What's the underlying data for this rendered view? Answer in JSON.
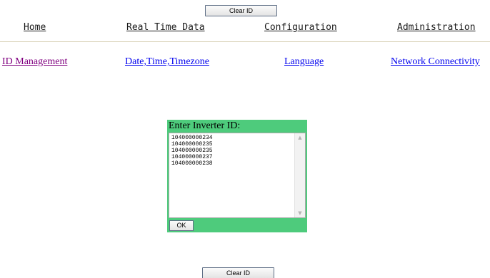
{
  "top_button": {
    "label": "Clear ID"
  },
  "bottom_button": {
    "label": "Clear ID"
  },
  "main_nav": {
    "home": "Home",
    "real_time_data": "Real Time Data",
    "configuration": "Configuration",
    "administration": "Administration"
  },
  "sub_nav": {
    "id_management": "ID Management",
    "date_time": "Date,Time,Timezone",
    "language": "Language",
    "network": "Network Connectivity"
  },
  "inverter_panel": {
    "title": "Enter Inverter ID:",
    "ids": [
      "104000000234",
      "104000000235",
      "104000000235",
      "104000000237",
      "104000000238"
    ],
    "ok_label": "OK"
  },
  "colors": {
    "panel_green": "#4ecb7c",
    "visited_link": "#800080",
    "link": "#0000ee"
  }
}
